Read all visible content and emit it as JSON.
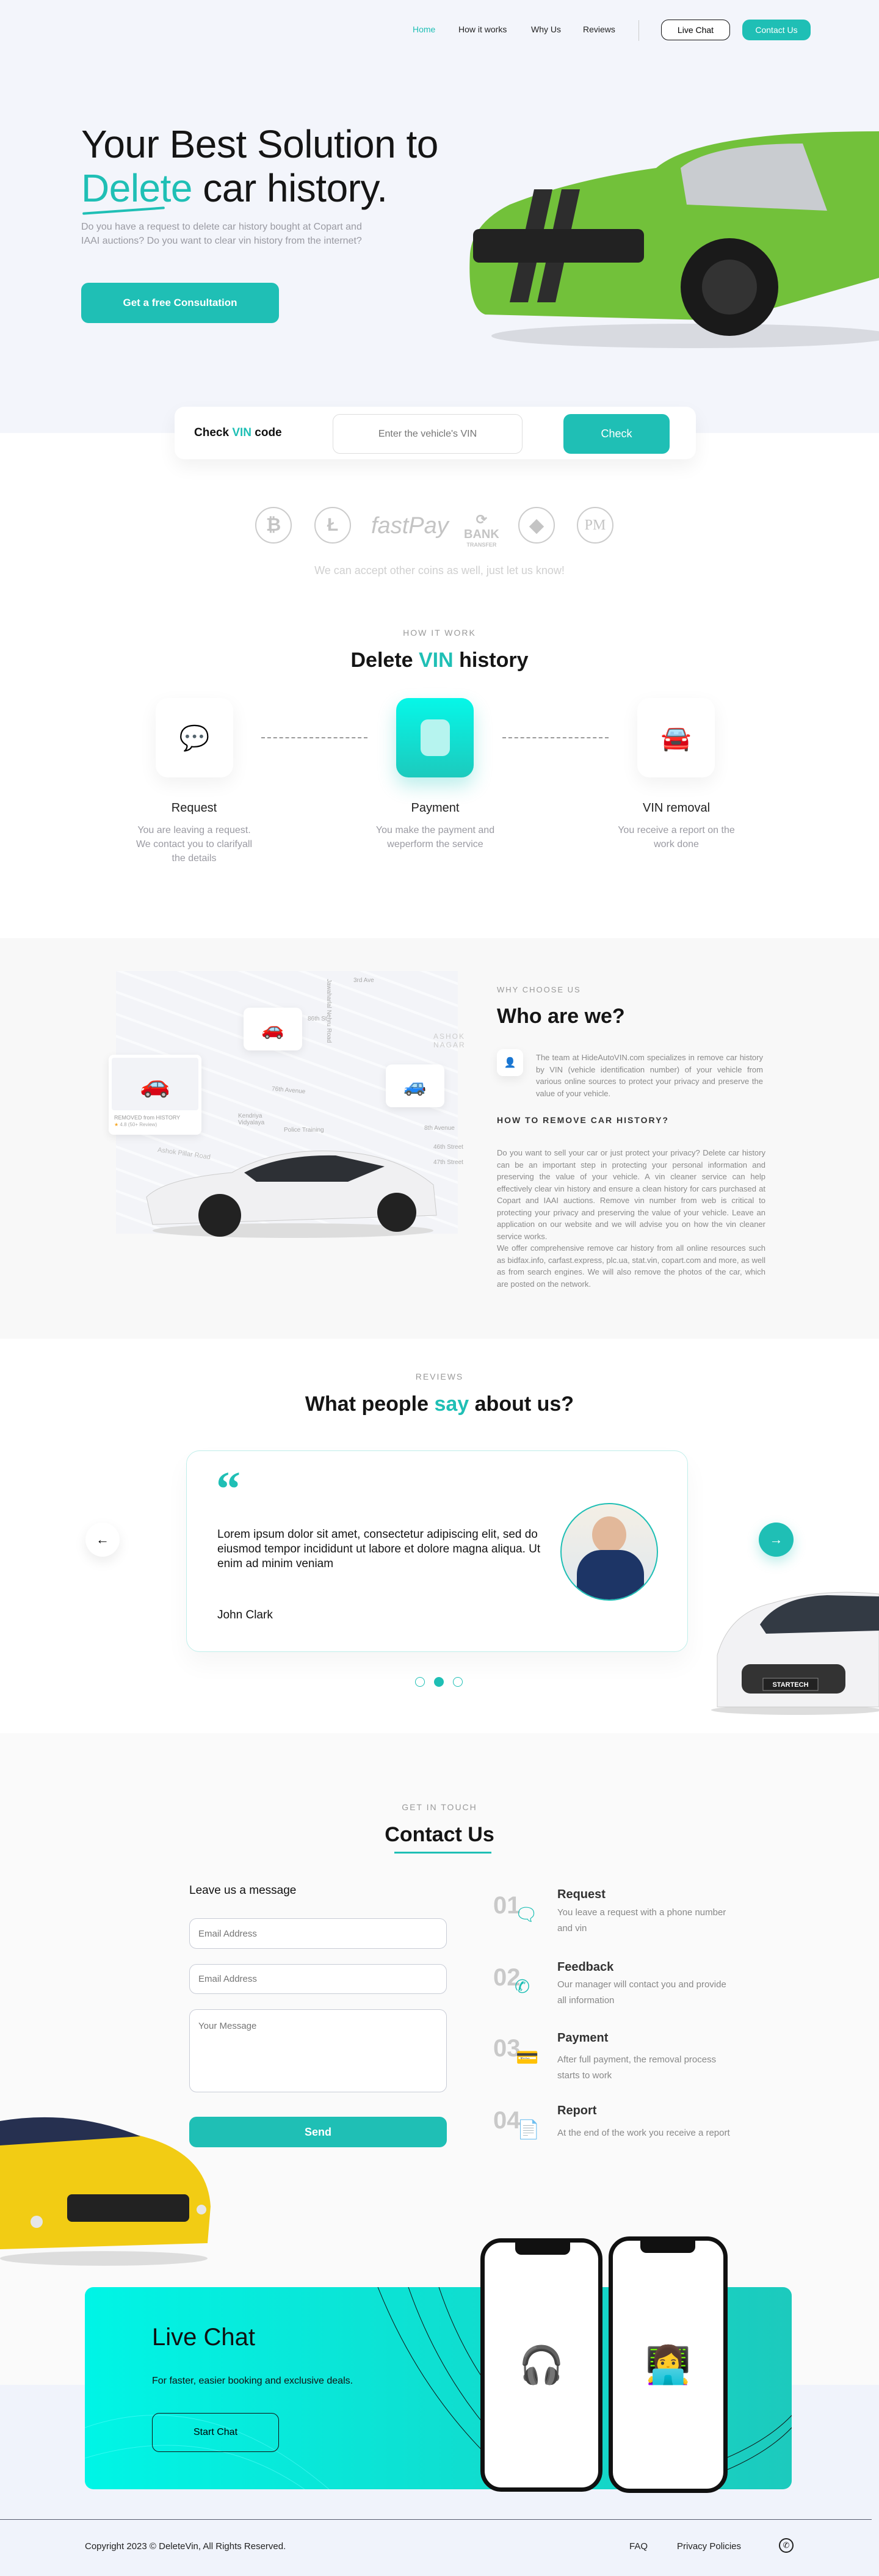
{
  "nav": {
    "items": [
      "Home",
      "How it works",
      "Why Us",
      "Reviews"
    ],
    "active": "Home",
    "live_chat": "Live Chat",
    "contact": "Contact Us"
  },
  "hero": {
    "title_line1": "Your Best Solution to",
    "title_accent": "Delete",
    "title_rest": " car history.",
    "subtitle": "Do you have a request to delete car history bought at Copart and IAAI auctions? Do you want to clear vin history from the internet?",
    "cta": "Get a free Consultation"
  },
  "vin": {
    "label_pre": "Check ",
    "label_accent": "VIN",
    "label_post": " code",
    "placeholder": "Enter the vehicle's VIN",
    "button": "Check"
  },
  "payments": {
    "icons": [
      "bitcoin-icon",
      "litecoin-icon",
      "fastpay-logo",
      "bank-transfer-icon",
      "ethereum-icon",
      "perfect-money-icon"
    ],
    "fastpay": "fastPay",
    "bank": "BANK",
    "bank_sub": "TRANSFER",
    "pm": "PM",
    "note": "We can accept other coins as well, just let us know!"
  },
  "how": {
    "eyebrow": "HOW IT WORK",
    "title_pre": "Delete ",
    "title_accent": "VIN",
    "title_post": " history",
    "steps": [
      {
        "title": "Request",
        "desc": "You are leaving a request. We contact you to clarifyall the details"
      },
      {
        "title": "Payment",
        "desc": "You make the payment and weperform the service"
      },
      {
        "title": "VIN removal",
        "desc": "You receive a report on the work done"
      }
    ]
  },
  "why": {
    "eyebrow": "WHY CHOOSE US",
    "title": "Who are we?",
    "intro": "The team at HideAutoVIN.com specializes in remove car history by VIN (vehicle identification number) of your vehicle from various online sources to protect your privacy and preserve the value of your vehicle.",
    "subheading": "HOW TO REMOVE CAR HISTORY?",
    "p1": "Do you want to sell your car or just protect your privacy? Delete car history can be an important step in protecting your personal information and preserving the value of your vehicle. A vin cleaner service can help effectively clear vin history and ensure a clean history for cars purchased at Copart and IAAI auctions. Remove vin number from web is critical to protecting your privacy and preserving the value of your vehicle. Leave an application on our website and we will advise you on how the vin cleaner service works.",
    "p2": "We offer comprehensive remove car history from all online resources such as bidfax.info, carfast.express, plc.ua, stat.vin, copart.com and more, as well as from search engines. We will also remove the photos of the car, which are posted on the network.",
    "map_card": {
      "label": "REMOVED from HISTORY",
      "rating": "4.8",
      "reviews": "(50+ Review)"
    },
    "map_labels": [
      "76th Avenue",
      "8th Avenue",
      "46th Street",
      "47th Street",
      "Kendriya Vidyalaya",
      "Police Training",
      "ASHOK NAGAR",
      "Ashok Pillar Road",
      "Jawaharlal Nehru Road",
      "86th St",
      "3rd Ave"
    ]
  },
  "reviews": {
    "eyebrow": "REVIEWS",
    "title_pre": "What people ",
    "title_accent": "say",
    "title_post": " about us?",
    "quote": "Lorem ipsum dolor sit amet, consectetur adipiscing elit, sed do eiusmod tempor incididunt ut labore et dolore magna aliqua. Ut enim ad minim veniam",
    "name": "John Clark",
    "active_dot": 2,
    "dots": 3,
    "car_plate": "STARTECH"
  },
  "contact": {
    "eyebrow": "GET IN TOUCH",
    "title": "Contact Us",
    "form_title": "Leave us a message",
    "field1": "Email Address",
    "field2": "Email Address",
    "message": "Your Message",
    "send": "Send",
    "steps": [
      {
        "num": "01",
        "title": "Request",
        "desc": "You leave a request with a phone number and vin"
      },
      {
        "num": "02",
        "title": "Feedback",
        "desc": "Our manager will contact you and provide all information"
      },
      {
        "num": "03",
        "title": "Payment",
        "desc": "After full payment, the removal process starts to work"
      },
      {
        "num": "04",
        "title": "Report",
        "desc": "At the end of the work you receive a report"
      }
    ]
  },
  "livechat": {
    "title": "Live Chat",
    "subtitle": "For faster, easier booking and exclusive deals.",
    "button": "Start Chat"
  },
  "footer": {
    "copyright": "Copyright 2023 © DeleteVin, All Rights Reserved.",
    "faq": "FAQ",
    "privacy": "Privacy Policies"
  },
  "colors": {
    "accent": "#1fbfb5",
    "hero_bg": "#f3f5fb",
    "chat_gradient_start": "#00f5e6",
    "chat_gradient_end": "#1ccabd"
  }
}
